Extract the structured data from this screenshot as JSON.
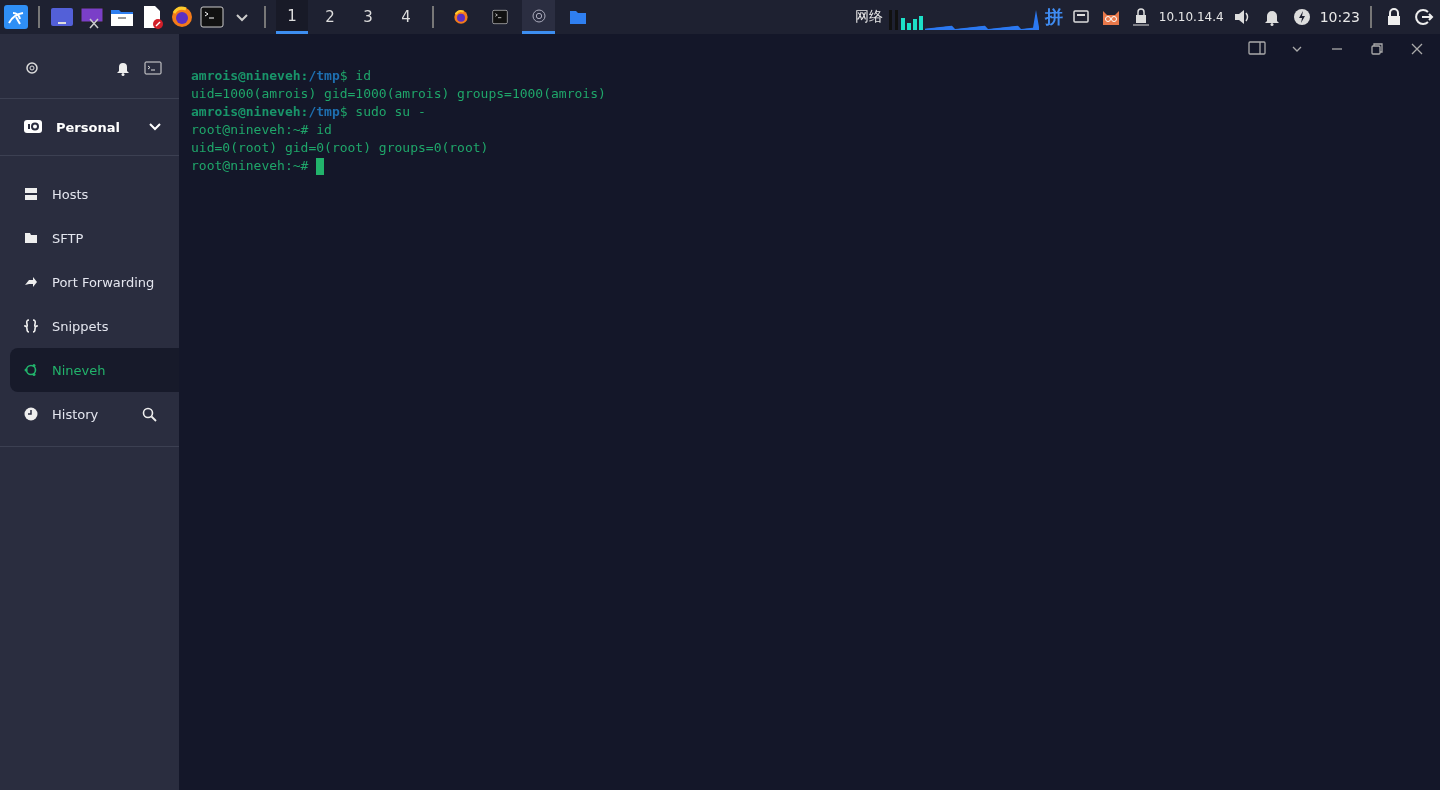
{
  "taskbar": {
    "launchers": [
      {
        "kind": "kali"
      },
      {
        "kind": "desktop"
      },
      {
        "kind": "screenshot"
      },
      {
        "kind": "folder"
      },
      {
        "kind": "editor"
      },
      {
        "kind": "firefox"
      },
      {
        "kind": "terminal"
      },
      {
        "kind": "caret"
      }
    ],
    "workspaces": [
      {
        "label": "1",
        "selected": true
      },
      {
        "label": "2",
        "selected": false
      },
      {
        "label": "3",
        "selected": false
      },
      {
        "label": "4",
        "selected": false
      }
    ],
    "tasks": [
      {
        "kind": "firefox",
        "selected": false
      },
      {
        "kind": "terminal",
        "selected": false
      },
      {
        "kind": "app",
        "selected": true
      },
      {
        "kind": "folder",
        "selected": false
      }
    ],
    "network_label": "网络",
    "ime": "拼",
    "ip": "10.10.14.4",
    "clock": "10:23"
  },
  "window_controls": [
    {
      "kind": "panel"
    },
    {
      "kind": "caret"
    },
    {
      "kind": "minimize"
    },
    {
      "kind": "restore"
    },
    {
      "kind": "close"
    }
  ],
  "sidebar": {
    "vault": "Personal",
    "items": [
      {
        "kind": "hosts",
        "label": "Hosts",
        "selected": false
      },
      {
        "kind": "sftp",
        "label": "SFTP",
        "selected": false
      },
      {
        "kind": "forward",
        "label": "Port Forwarding",
        "selected": false
      },
      {
        "kind": "snippets",
        "label": "Snippets",
        "selected": false
      },
      {
        "kind": "host",
        "label": "Nineveh",
        "selected": true
      },
      {
        "kind": "history",
        "label": "History",
        "selected": false
      }
    ]
  },
  "terminal": {
    "lines": [
      [
        {
          "kind": "user",
          "text": "amrois@nineveh:"
        },
        {
          "kind": "path",
          "text": "/tmp"
        },
        {
          "kind": "plain",
          "text": "$ id"
        }
      ],
      [
        {
          "kind": "plain",
          "text": "uid=1000(amrois) gid=1000(amrois) groups=1000(amrois)"
        }
      ],
      [
        {
          "kind": "user",
          "text": "amrois@nineveh:"
        },
        {
          "kind": "path",
          "text": "/tmp"
        },
        {
          "kind": "plain",
          "text": "$ sudo su -"
        }
      ],
      [
        {
          "kind": "plain",
          "text": "root@nineveh:~# id"
        }
      ],
      [
        {
          "kind": "plain",
          "text": "uid=0(root) gid=0(root) groups=0(root)"
        }
      ],
      [
        {
          "kind": "plain",
          "text": "root@nineveh:~# "
        }
      ]
    ],
    "cursor": true
  }
}
